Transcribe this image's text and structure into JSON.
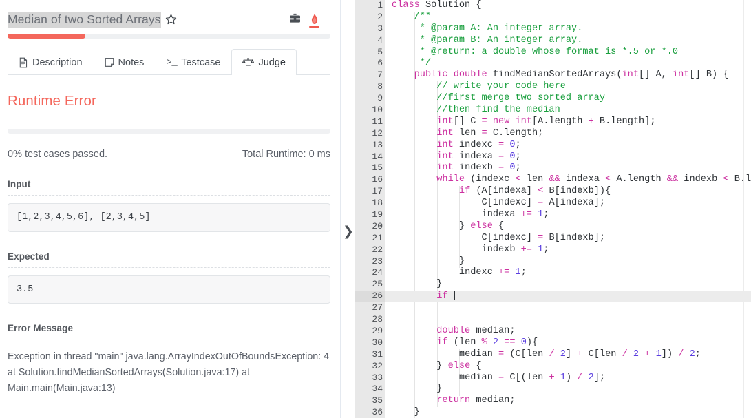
{
  "problem": {
    "title": "Median of two Sorted Arrays",
    "star_icon": "star-outline-icon",
    "briefcase_icon": "briefcase-icon",
    "flame_icon": "flame-icon",
    "top_progress_percent": 24
  },
  "tabs": [
    {
      "label": "Description",
      "icon": "document-icon",
      "active": false
    },
    {
      "label": "Notes",
      "icon": "note-icon",
      "active": false
    },
    {
      "label": "Testcase",
      "icon": "terminal-prompt-icon",
      "prompt": ">_",
      "active": false
    },
    {
      "label": "Judge",
      "icon": "scales-icon",
      "active": true
    }
  ],
  "judge": {
    "verdict": "Runtime Error",
    "verdict_color": "#f4675c",
    "progress_percent": 0,
    "test_cases_passed": "0% test cases passed.",
    "total_runtime": "Total Runtime: 0 ms",
    "input_label": "Input",
    "input_value": "[1,2,3,4,5,6], [2,3,4,5]",
    "expected_label": "Expected",
    "expected_value": "3.5",
    "error_label": "Error Message",
    "error_message": "Exception in thread \"main\" java.lang.ArrayIndexOutOfBoundsException: 4 at Solution.findMedianSortedArrays(Solution.java:17) at Main.main(Main.java:13)"
  },
  "editor": {
    "collapse_handle": "❯",
    "active_line": 26,
    "cursor_line": 26,
    "language": "java",
    "fold_lines": [
      1,
      2,
      7,
      16,
      17,
      20,
      30,
      32
    ],
    "lines": [
      {
        "n": 1,
        "indent": 0,
        "tokens": [
          {
            "t": "kw",
            "v": "class"
          },
          {
            "t": "pl",
            "v": " Solution {"
          }
        ]
      },
      {
        "n": 2,
        "indent": 1,
        "tokens": [
          {
            "t": "cm",
            "v": "/**"
          }
        ]
      },
      {
        "n": 3,
        "indent": 1,
        "tokens": [
          {
            "t": "cm",
            "v": " * @param A: An integer array."
          }
        ]
      },
      {
        "n": 4,
        "indent": 1,
        "tokens": [
          {
            "t": "cm",
            "v": " * @param B: An integer array."
          }
        ]
      },
      {
        "n": 5,
        "indent": 1,
        "tokens": [
          {
            "t": "cm",
            "v": " * @return: a double whose format is *.5 or *.0"
          }
        ]
      },
      {
        "n": 6,
        "indent": 1,
        "tokens": [
          {
            "t": "cm",
            "v": " */"
          }
        ]
      },
      {
        "n": 7,
        "indent": 1,
        "tokens": [
          {
            "t": "kw",
            "v": "public double"
          },
          {
            "t": "pl",
            "v": " findMedianSortedArrays("
          },
          {
            "t": "kw",
            "v": "int"
          },
          {
            "t": "pl",
            "v": "[] A, "
          },
          {
            "t": "kw",
            "v": "int"
          },
          {
            "t": "pl",
            "v": "[] B) {"
          }
        ]
      },
      {
        "n": 8,
        "indent": 2,
        "tokens": [
          {
            "t": "cm",
            "v": "// write your code here"
          }
        ]
      },
      {
        "n": 9,
        "indent": 2,
        "tokens": [
          {
            "t": "cm",
            "v": "//first merge two sorted array"
          }
        ]
      },
      {
        "n": 10,
        "indent": 2,
        "tokens": [
          {
            "t": "cm",
            "v": "//then find the median"
          }
        ]
      },
      {
        "n": 11,
        "indent": 2,
        "tokens": [
          {
            "t": "kw",
            "v": "int"
          },
          {
            "t": "pl",
            "v": "[] C "
          },
          {
            "t": "op",
            "v": "="
          },
          {
            "t": "pl",
            "v": " "
          },
          {
            "t": "kw",
            "v": "new int"
          },
          {
            "t": "pl",
            "v": "[A.length "
          },
          {
            "t": "op",
            "v": "+"
          },
          {
            "t": "pl",
            "v": " B.length];"
          }
        ]
      },
      {
        "n": 12,
        "indent": 2,
        "tokens": [
          {
            "t": "kw",
            "v": "int"
          },
          {
            "t": "pl",
            "v": " len "
          },
          {
            "t": "op",
            "v": "="
          },
          {
            "t": "pl",
            "v": " C.length;"
          }
        ]
      },
      {
        "n": 13,
        "indent": 2,
        "tokens": [
          {
            "t": "kw",
            "v": "int"
          },
          {
            "t": "pl",
            "v": " indexc "
          },
          {
            "t": "op",
            "v": "="
          },
          {
            "t": "pl",
            "v": " "
          },
          {
            "t": "num",
            "v": "0"
          },
          {
            "t": "pl",
            "v": ";"
          }
        ]
      },
      {
        "n": 14,
        "indent": 2,
        "tokens": [
          {
            "t": "kw",
            "v": "int"
          },
          {
            "t": "pl",
            "v": " indexa "
          },
          {
            "t": "op",
            "v": "="
          },
          {
            "t": "pl",
            "v": " "
          },
          {
            "t": "num",
            "v": "0"
          },
          {
            "t": "pl",
            "v": ";"
          }
        ]
      },
      {
        "n": 15,
        "indent": 2,
        "tokens": [
          {
            "t": "kw",
            "v": "int"
          },
          {
            "t": "pl",
            "v": " indexb "
          },
          {
            "t": "op",
            "v": "="
          },
          {
            "t": "pl",
            "v": " "
          },
          {
            "t": "num",
            "v": "0"
          },
          {
            "t": "pl",
            "v": ";"
          }
        ]
      },
      {
        "n": 16,
        "indent": 2,
        "tokens": [
          {
            "t": "kw",
            "v": "while"
          },
          {
            "t": "pl",
            "v": " (indexc "
          },
          {
            "t": "op",
            "v": "<"
          },
          {
            "t": "pl",
            "v": " len "
          },
          {
            "t": "op",
            "v": "&&"
          },
          {
            "t": "pl",
            "v": " indexa "
          },
          {
            "t": "op",
            "v": "<"
          },
          {
            "t": "pl",
            "v": " A.length "
          },
          {
            "t": "op",
            "v": "&&"
          },
          {
            "t": "pl",
            "v": " indexb "
          },
          {
            "t": "op",
            "v": "<"
          },
          {
            "t": "pl",
            "v": " B.leng"
          }
        ]
      },
      {
        "n": 17,
        "indent": 3,
        "tokens": [
          {
            "t": "kw",
            "v": "if"
          },
          {
            "t": "pl",
            "v": " (A[indexa] "
          },
          {
            "t": "op",
            "v": "<"
          },
          {
            "t": "pl",
            "v": " B[indexb]){"
          }
        ]
      },
      {
        "n": 18,
        "indent": 4,
        "tokens": [
          {
            "t": "pl",
            "v": "C[indexc] "
          },
          {
            "t": "op",
            "v": "="
          },
          {
            "t": "pl",
            "v": " A[indexa];"
          }
        ]
      },
      {
        "n": 19,
        "indent": 4,
        "tokens": [
          {
            "t": "pl",
            "v": "indexa "
          },
          {
            "t": "op",
            "v": "+="
          },
          {
            "t": "pl",
            "v": " "
          },
          {
            "t": "num",
            "v": "1"
          },
          {
            "t": "pl",
            "v": ";"
          }
        ]
      },
      {
        "n": 20,
        "indent": 3,
        "tokens": [
          {
            "t": "pl",
            "v": "} "
          },
          {
            "t": "kw",
            "v": "else"
          },
          {
            "t": "pl",
            "v": " {"
          }
        ]
      },
      {
        "n": 21,
        "indent": 4,
        "tokens": [
          {
            "t": "pl",
            "v": "C[indexc] "
          },
          {
            "t": "op",
            "v": "="
          },
          {
            "t": "pl",
            "v": " B[indexb];"
          }
        ]
      },
      {
        "n": 22,
        "indent": 4,
        "tokens": [
          {
            "t": "pl",
            "v": "indexb "
          },
          {
            "t": "op",
            "v": "+="
          },
          {
            "t": "pl",
            "v": " "
          },
          {
            "t": "num",
            "v": "1"
          },
          {
            "t": "pl",
            "v": ";"
          }
        ]
      },
      {
        "n": 23,
        "indent": 3,
        "tokens": [
          {
            "t": "pl",
            "v": "}"
          }
        ]
      },
      {
        "n": 24,
        "indent": 3,
        "tokens": [
          {
            "t": "pl",
            "v": "indexc "
          },
          {
            "t": "op",
            "v": "+="
          },
          {
            "t": "pl",
            "v": " "
          },
          {
            "t": "num",
            "v": "1"
          },
          {
            "t": "pl",
            "v": ";"
          }
        ]
      },
      {
        "n": 25,
        "indent": 2,
        "tokens": [
          {
            "t": "pl",
            "v": "}"
          }
        ]
      },
      {
        "n": 26,
        "indent": 2,
        "tokens": [
          {
            "t": "kw",
            "v": "if"
          },
          {
            "t": "pl",
            "v": " "
          }
        ],
        "cursor": true
      },
      {
        "n": 27,
        "indent": 0,
        "tokens": []
      },
      {
        "n": 28,
        "indent": 0,
        "tokens": []
      },
      {
        "n": 29,
        "indent": 2,
        "tokens": [
          {
            "t": "kw",
            "v": "double"
          },
          {
            "t": "pl",
            "v": " median;"
          }
        ]
      },
      {
        "n": 30,
        "indent": 2,
        "tokens": [
          {
            "t": "kw",
            "v": "if"
          },
          {
            "t": "pl",
            "v": " (len "
          },
          {
            "t": "op",
            "v": "%"
          },
          {
            "t": "pl",
            "v": " "
          },
          {
            "t": "num",
            "v": "2"
          },
          {
            "t": "pl",
            "v": " "
          },
          {
            "t": "op",
            "v": "=="
          },
          {
            "t": "pl",
            "v": " "
          },
          {
            "t": "num",
            "v": "0"
          },
          {
            "t": "pl",
            "v": "){"
          }
        ]
      },
      {
        "n": 31,
        "indent": 3,
        "tokens": [
          {
            "t": "pl",
            "v": "median "
          },
          {
            "t": "op",
            "v": "="
          },
          {
            "t": "pl",
            "v": " (C[len "
          },
          {
            "t": "op",
            "v": "/"
          },
          {
            "t": "pl",
            "v": " "
          },
          {
            "t": "num",
            "v": "2"
          },
          {
            "t": "pl",
            "v": "] "
          },
          {
            "t": "op",
            "v": "+"
          },
          {
            "t": "pl",
            "v": " C[len "
          },
          {
            "t": "op",
            "v": "/"
          },
          {
            "t": "pl",
            "v": " "
          },
          {
            "t": "num",
            "v": "2"
          },
          {
            "t": "pl",
            "v": " "
          },
          {
            "t": "op",
            "v": "+"
          },
          {
            "t": "pl",
            "v": " "
          },
          {
            "t": "num",
            "v": "1"
          },
          {
            "t": "pl",
            "v": "]) "
          },
          {
            "t": "op",
            "v": "/"
          },
          {
            "t": "pl",
            "v": " "
          },
          {
            "t": "num",
            "v": "2"
          },
          {
            "t": "pl",
            "v": ";"
          }
        ]
      },
      {
        "n": 32,
        "indent": 2,
        "tokens": [
          {
            "t": "pl",
            "v": "} "
          },
          {
            "t": "kw",
            "v": "else"
          },
          {
            "t": "pl",
            "v": " {"
          }
        ]
      },
      {
        "n": 33,
        "indent": 3,
        "tokens": [
          {
            "t": "pl",
            "v": "median "
          },
          {
            "t": "op",
            "v": "="
          },
          {
            "t": "pl",
            "v": " C[(len "
          },
          {
            "t": "op",
            "v": "+"
          },
          {
            "t": "pl",
            "v": " "
          },
          {
            "t": "num",
            "v": "1"
          },
          {
            "t": "pl",
            "v": ") "
          },
          {
            "t": "op",
            "v": "/"
          },
          {
            "t": "pl",
            "v": " "
          },
          {
            "t": "num",
            "v": "2"
          },
          {
            "t": "pl",
            "v": "];"
          }
        ]
      },
      {
        "n": 34,
        "indent": 2,
        "tokens": [
          {
            "t": "pl",
            "v": "}"
          }
        ]
      },
      {
        "n": 35,
        "indent": 2,
        "tokens": [
          {
            "t": "kw",
            "v": "return"
          },
          {
            "t": "pl",
            "v": " median;"
          }
        ]
      },
      {
        "n": 36,
        "indent": 1,
        "tokens": [
          {
            "t": "pl",
            "v": "}"
          }
        ]
      }
    ]
  },
  "colors": {
    "accent_red": "#f4675c",
    "keyword": "#cc31a0",
    "comment": "#1a9f3e",
    "number": "#5b3fe0",
    "gutter_bg": "#e8e8e8"
  }
}
